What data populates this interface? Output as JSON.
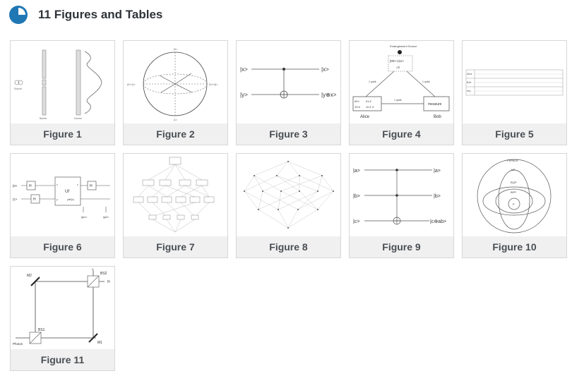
{
  "header": {
    "title": "11 Figures and Tables",
    "icon": "pie-chart-icon",
    "accent": "#1f77b4"
  },
  "figures": [
    {
      "caption": "Figure 1",
      "labels": {
        "source": "Source",
        "barrier": "Barrier",
        "screen": "Screen"
      }
    },
    {
      "caption": "Figure 2",
      "labels": {
        "top": "|0>",
        "bottom": "|1>",
        "left": "|0>+|1>",
        "right": "|0>+i|1>"
      }
    },
    {
      "caption": "Figure 3",
      "labels": {
        "in_x": "|x>",
        "in_y": "|y>",
        "out_x": "|x>",
        "out_y": "|y⊕x>"
      }
    },
    {
      "caption": "Figure 4",
      "labels": {
        "source_title": "Entanglement Source",
        "state": "|00>+|11>",
        "norm": "√2",
        "qubit_left": "1 qubit",
        "qubit_right": "1 qubit",
        "qubit_mid": "1 qubit",
        "table_r1c1": "00:I",
        "table_r1c2": "01:Z",
        "table_r2c1": "10:X",
        "table_r2c2": "11:Z X",
        "measure": "measure",
        "alice": "Alice",
        "bob": "Bob"
      }
    },
    {
      "caption": "Figure 5",
      "labels": {
        "row1": "Alice",
        "row2": "Bob",
        "row3": "key"
      }
    },
    {
      "caption": "Figure 6",
      "labels": {
        "in0": "|0>",
        "in1": "|1>",
        "gate_h": "H",
        "uf": "Uf",
        "x": "x",
        "y": "y",
        "yfx": "y⊕f(x)",
        "psi1": "|ψ1>",
        "psi2": "|ψ2>"
      }
    },
    {
      "caption": "Figure 7",
      "labels": {}
    },
    {
      "caption": "Figure 8",
      "labels": {}
    },
    {
      "caption": "Figure 9",
      "labels": {
        "a_in": "|a>",
        "b_in": "|b>",
        "c_in": "|c>",
        "a_out": "|a>",
        "b_out": "|b>",
        "c_out": "|c⊕ab>"
      }
    },
    {
      "caption": "Figure 10",
      "labels": {
        "pspace": "PSPACE",
        "np": "NP",
        "bqp": "BQP",
        "bpp": "BPP",
        "p": "P"
      }
    },
    {
      "caption": "Figure 11",
      "labels": {
        "m1": "M1",
        "m2": "M2",
        "bs1": "BS1",
        "bs2": "BS2",
        "h": "H",
        "v": "V",
        "photon": "Photon"
      }
    }
  ]
}
